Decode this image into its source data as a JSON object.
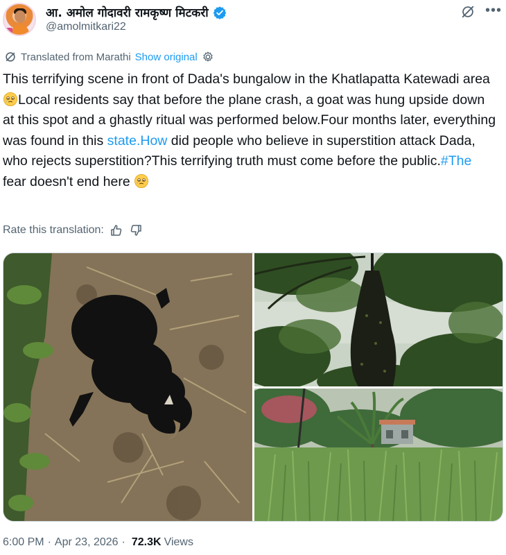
{
  "author": {
    "display_name": "आ. अमोल गोदावरी रामकृष्ण मिटकरी",
    "handle": "@amolmitkari22",
    "verified": true
  },
  "translation": {
    "label": "Translated from Marathi",
    "show_original": "Show original"
  },
  "tweet": {
    "part1": "This terrifying scene in front of Dada's bungalow in the Khatlapatta Katewadi area ",
    "part2": "Local residents say that before the plane crash, a goat was hung upside down at this spot and a ghastly ritual was performed below.Four months later, everything was found in this ",
    "link1": "state.How",
    "part3": " did people who believe in superstition attack Dada, who rejects superstition?This terrifying truth must come before the public.",
    "link2": "#The",
    "part4": " fear doesn't end here ",
    "emoji": "crying-face-emoji"
  },
  "rate": {
    "label": "Rate this translation:"
  },
  "media": {
    "photos": [
      {
        "name": "photo-dead-goat-on-ground"
      },
      {
        "name": "photo-goat-hanging-from-tree"
      },
      {
        "name": "photo-field-with-watchtower"
      }
    ]
  },
  "meta": {
    "time": "6:00 PM",
    "date": "Apr 23, 2026",
    "views_count": "72.3K",
    "views_label": "Views"
  },
  "colors": {
    "link": "#1d9bf0",
    "secondary_text": "#536471",
    "verified": "#1d9bf0"
  }
}
